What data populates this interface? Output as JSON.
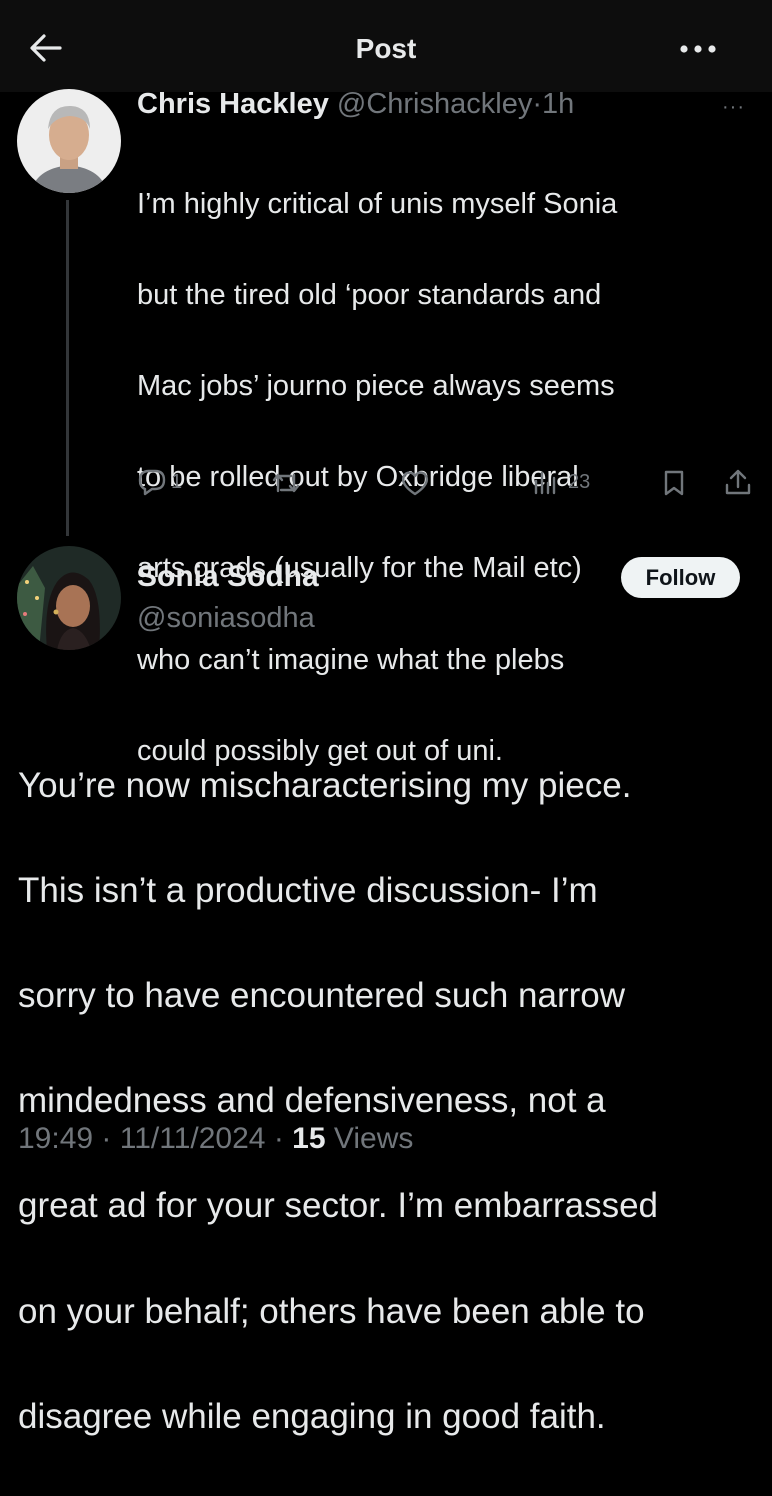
{
  "header": {
    "title": "Post"
  },
  "reply": {
    "name": "Chris Hackley",
    "handle": "@Chrishackley",
    "separator": "·",
    "time": "1h",
    "more": "···",
    "text_lines": [
      "I’m highly critical of unis myself Sonia",
      "but the tired old ‘poor standards and",
      "Mac jobs’ journo piece always seems",
      "to be rolled out by Oxbridge liberal",
      "arts grads (usually for the Mail etc)",
      "who can’t imagine what the plebs",
      "could possibly get out of uni."
    ],
    "reply_count": "1",
    "views": "23"
  },
  "post": {
    "name": "Sonia Sodha",
    "handle": "@soniasodha",
    "follow_label": "Follow",
    "text_lines": [
      "You’re now mischaracterising my piece.",
      "This isn’t a productive discussion- I’m",
      "sorry to have encountered such narrow",
      "mindedness and defensiveness, not a",
      "great ad for your sector.  I’m embarrassed",
      "on your behalf; others have been able to",
      "disagree while engaging in good faith."
    ],
    "time": "19:49",
    "separator": "·",
    "date": "11/11/2024",
    "views_count": "15",
    "views_label": "Views"
  },
  "colors": {
    "background": "#000000",
    "text": "#e7e9ea",
    "muted": "#71767b",
    "follow_bg": "#eff3f4"
  },
  "icons": [
    "back-arrow-icon",
    "more-icon",
    "reply-icon",
    "repost-icon",
    "like-icon",
    "views-icon",
    "bookmark-icon",
    "share-icon"
  ]
}
